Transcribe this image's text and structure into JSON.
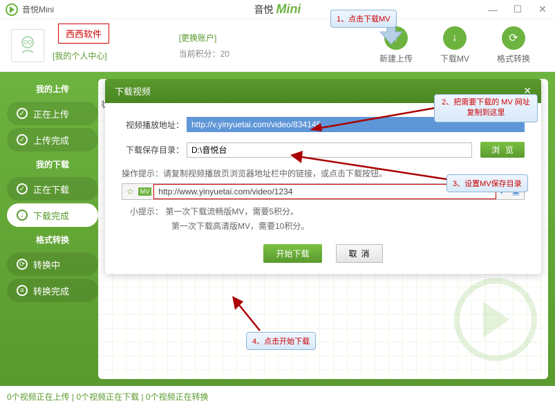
{
  "titlebar": {
    "app_name": "音悦Mini",
    "brand_left": "音悦",
    "brand_right": "Mini"
  },
  "callouts": {
    "c1": "1、点击下载MV",
    "c2": "2、把需要下载的 MV 网址复制到这里",
    "c3": "3、设置MV保存目录",
    "c4": "4、点击开始下载"
  },
  "header": {
    "xisi": "西西软件",
    "my_center": "[我的个人中心]",
    "switch_account": "[更换账户]",
    "points_label": "当前积分：",
    "points_value": "20",
    "actions": {
      "upload": "新建上传",
      "download": "下载MV",
      "convert": "格式转换"
    }
  },
  "sidebar": {
    "groups": [
      {
        "title": "我的上传",
        "items": [
          {
            "icon": "✓",
            "label": "正在上传"
          },
          {
            "icon": "✓",
            "label": "上传完成"
          }
        ]
      },
      {
        "title": "我的下载",
        "items": [
          {
            "icon": "✓",
            "label": "正在下载"
          },
          {
            "icon": "↓",
            "label": "下载完成",
            "active": true
          }
        ]
      },
      {
        "title": "格式转换",
        "items": [
          {
            "icon": "⟳",
            "label": "转换中"
          },
          {
            "icon": "≡",
            "label": "转换完成"
          }
        ]
      }
    ]
  },
  "content_tab": "状",
  "dialog": {
    "title": "下载视频",
    "video_url_label": "视频播放地址：",
    "video_url_value": "http://v.yinyuetai.com/video/834145",
    "save_dir_label": "下载保存目录：",
    "save_dir_value": "D:\\音悦台",
    "browse": "浏览",
    "op_hint": "操作提示：请复制视频播放页浏览器地址栏中的链接，或点击下载按钮。",
    "example_url": "http://www.yinyuetai.com/video/1234",
    "small_hint1": "小提示：   第一次下载流畅版MV，需要5积分。",
    "small_hint2": "第一次下载高清版MV，需要10积分。",
    "start": "开始下载",
    "cancel": "取消"
  },
  "statusbar": "0个视频正在上传 | 0个视频正在下载 | 0个视频正在转换"
}
